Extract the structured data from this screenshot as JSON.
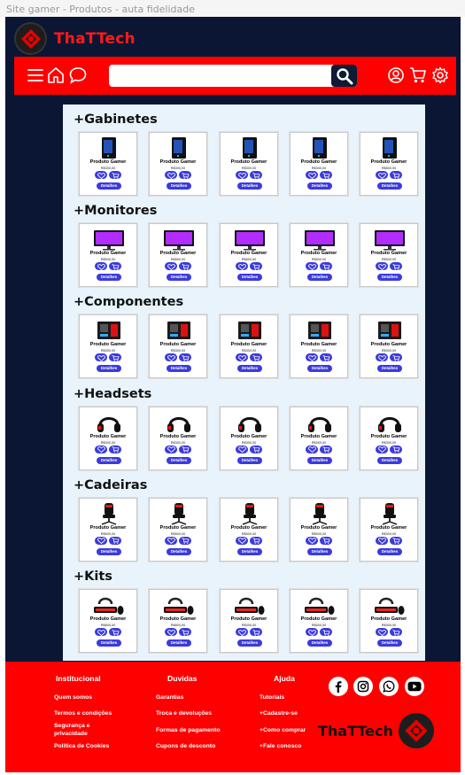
{
  "window": {
    "title": "Site gamer -  Produtos - auta fidelidade"
  },
  "brand": {
    "name": "ThaTTech",
    "color": "#ff1a1a"
  },
  "colors": {
    "background": "#0a1633",
    "accent": "#ff0000",
    "panel": "#e8f3fb",
    "button": "#3b3bdd"
  },
  "nav": {
    "icons": [
      "menu-icon",
      "home-icon",
      "chat-icon"
    ],
    "search_placeholder": "",
    "right_icons": [
      "user-icon",
      "cart-icon",
      "settings-icon"
    ]
  },
  "categories": [
    {
      "title": "+Gabinetes",
      "kind": "case",
      "products": [
        {
          "name": "Produto Gamer",
          "price": "R$300,00"
        },
        {
          "name": "Produto Gamer",
          "price": "R$300,00"
        },
        {
          "name": "Produto Gamer",
          "price": "R$300,00"
        },
        {
          "name": "Produto Gamer",
          "price": "R$300,00"
        },
        {
          "name": "Produto Gamer",
          "price": "R$800,00"
        }
      ]
    },
    {
      "title": "+Monitores",
      "kind": "monitor",
      "products": [
        {
          "name": "Produto Gamer",
          "price": "R$500,00"
        },
        {
          "name": "Produto Gamer",
          "price": "R$800,00"
        },
        {
          "name": "Produto Gamer",
          "price": "R$600,00"
        },
        {
          "name": "Produto Gamer",
          "price": "R$800,00"
        },
        {
          "name": "Produto Gamer",
          "price": "R$500,00"
        }
      ]
    },
    {
      "title": "+Componentes",
      "kind": "component",
      "products": [
        {
          "name": "Produto Gamer",
          "price": "R$300,00"
        },
        {
          "name": "Produto Gamer",
          "price": "R$300,00"
        },
        {
          "name": "Produto Gamer",
          "price": "R$300,00"
        },
        {
          "name": "Produto Gamer",
          "price": "R$300,00"
        },
        {
          "name": "Produto Gamer",
          "price": "R$300,00"
        }
      ]
    },
    {
      "title": "+Headsets",
      "kind": "headset",
      "products": [
        {
          "name": "Produto Gamer",
          "price": "R$300,00"
        },
        {
          "name": "Produto Gamer",
          "price": "R$300,00"
        },
        {
          "name": "Produto Gamer",
          "price": "R$300,00"
        },
        {
          "name": "Produto Gamer",
          "price": "R$300,00"
        },
        {
          "name": "Produto Gamer",
          "price": "R$300,00"
        }
      ]
    },
    {
      "title": "+Cadeiras",
      "kind": "chair",
      "products": [
        {
          "name": "Produto Gamer",
          "price": "R$500,00"
        },
        {
          "name": "Produto Gamer",
          "price": "R$500,00"
        },
        {
          "name": "Produto Gamer",
          "price": "R$500,00"
        },
        {
          "name": "Produto Gamer",
          "price": "R$500,00"
        },
        {
          "name": "Produto Gamer",
          "price": "R$300,00"
        }
      ]
    },
    {
      "title": "+Kits",
      "kind": "kit",
      "products": [
        {
          "name": "Produto Gamer",
          "price": "R$800,00"
        },
        {
          "name": "Produto Gamer",
          "price": "R$800,00"
        },
        {
          "name": "Produto Gamer",
          "price": "R$300,00"
        },
        {
          "name": "Produto Gamer",
          "price": "R$500,00"
        },
        {
          "name": "Produto Gamer",
          "price": "R$300,00"
        }
      ]
    }
  ],
  "card_labels": {
    "details": "Detalhes"
  },
  "footer": {
    "columns": [
      {
        "title": "Institucional",
        "links": [
          "Quem somos",
          "Termos e condições",
          "Segurança e privacidade",
          "Política de Cookies"
        ]
      },
      {
        "title": "Duvidas",
        "links": [
          "Garantias",
          "Troca e devoluções",
          "Formas de pagamento",
          "Cupons de desconto"
        ]
      },
      {
        "title": "Ajuda",
        "links": [
          "Tutoriais",
          "+Cadastre-se",
          "+Como comprar",
          "+Fale conosco"
        ]
      }
    ],
    "social": [
      "facebook-icon",
      "instagram-icon",
      "whatsapp-icon",
      "youtube-icon"
    ],
    "brand": "ThaTTech"
  }
}
